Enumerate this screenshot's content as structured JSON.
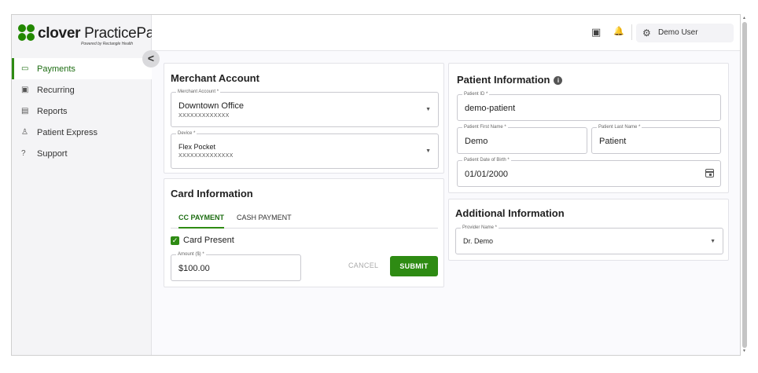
{
  "brand": {
    "name_bold": "clover",
    "name_regular": "PracticePay",
    "trademark": "™",
    "tagline": "Powered by Rectangle Health"
  },
  "sidebar": {
    "collapse_glyph": "<",
    "items": [
      {
        "label": "Payments",
        "icon": "credit-card-icon",
        "glyph": "▭",
        "active": true
      },
      {
        "label": "Recurring",
        "icon": "money-icon",
        "glyph": "▣",
        "active": false
      },
      {
        "label": "Reports",
        "icon": "report-icon",
        "glyph": "▤",
        "active": false
      },
      {
        "label": "Patient Express",
        "icon": "person-icon",
        "glyph": "♙",
        "active": false
      },
      {
        "label": "Support",
        "icon": "help-icon",
        "glyph": "?",
        "active": false
      }
    ]
  },
  "topbar": {
    "terminal_glyph": "▣",
    "bell_glyph": "🔔",
    "gear_glyph": "⚙",
    "user_name": "Demo User"
  },
  "merchant": {
    "title": "Merchant Account",
    "account_label": "Merchant Account *",
    "account_value": "Downtown Office",
    "account_sub": "XXXXXXXXXXXXX",
    "device_label": "Device *",
    "device_value": "Flex Pocket",
    "device_sub": "XXXXXXXXXXXXXX",
    "arrow": "▼"
  },
  "card_info": {
    "title": "Card Information",
    "tabs": [
      "CC PAYMENT",
      "CASH PAYMENT"
    ],
    "card_present_label": "Card Present",
    "card_present_checked": true,
    "check_glyph": "✓",
    "amount_label": "Amount ($) *",
    "amount_value": "$100.00",
    "cancel_label": "CANCEL",
    "submit_label": "SUBMIT"
  },
  "patient": {
    "title": "Patient Information",
    "info_glyph": "i",
    "id_label": "Patient ID *",
    "id_value": "demo-patient",
    "first_label": "Patient First Name *",
    "first_value": "Demo",
    "last_label": "Patient Last Name *",
    "last_value": "Patient",
    "dob_label": "Patient Date of Birth *",
    "dob_value": "01/01/2000"
  },
  "additional": {
    "title": "Additional Information",
    "provider_label": "Provider Name *",
    "provider_value": "Dr. Demo",
    "arrow": "▼"
  },
  "colors": {
    "accent": "#2e8b13",
    "accent_dark": "#1d6d12"
  }
}
